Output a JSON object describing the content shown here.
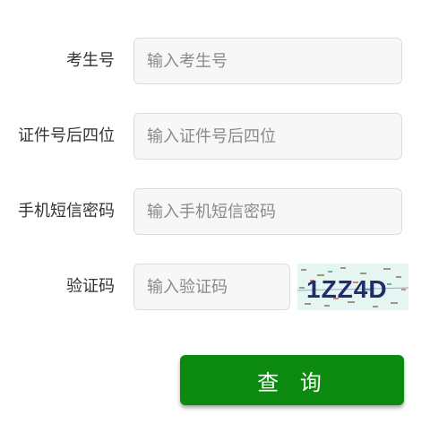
{
  "form": {
    "exam_no": {
      "label": "考生号",
      "placeholder": "输入考生号",
      "value": ""
    },
    "id_last4": {
      "label": "证件号后四位",
      "placeholder": "输入证件号后四位",
      "value": ""
    },
    "sms_password": {
      "label": "手机短信密码",
      "placeholder": "输入手机短信密码",
      "value": ""
    },
    "captcha": {
      "label": "验证码",
      "placeholder": "输入验证码",
      "value": "",
      "image_text": "1ZZ4D"
    },
    "submit_label": "查 询"
  },
  "colors": {
    "submit_bg": "#0b8a0f",
    "field_bg": "#f7f7f7",
    "field_border": "#dcdcdc",
    "captcha_bg": "#e4f5f2"
  }
}
